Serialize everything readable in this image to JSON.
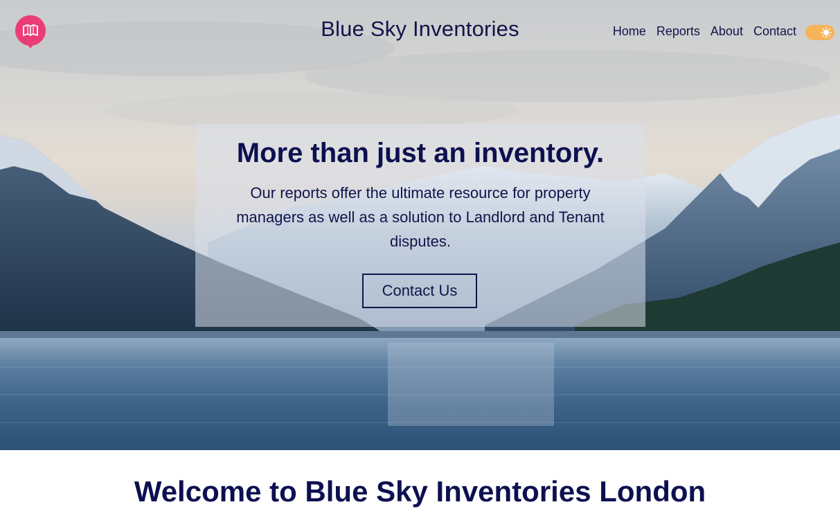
{
  "header": {
    "site_title": "Blue Sky Inventories",
    "logo_icon": "map-pin-book-icon",
    "nav": [
      {
        "label": "Home"
      },
      {
        "label": "Reports"
      },
      {
        "label": "About"
      },
      {
        "label": "Contact"
      }
    ],
    "theme_toggle_icon": "sun-icon"
  },
  "hero": {
    "background_image": "mountain-lake-landscape",
    "headline": "More than just an inventory.",
    "body": "Our reports offer the ultimate resource for property managers as well as a solution to Landlord and Tenant disputes.",
    "cta_label": "Contact Us"
  },
  "welcome": {
    "heading": "Welcome to Blue Sky Inventories London"
  },
  "colors": {
    "navy_text": "#11144a",
    "logo_pink": "#ea3d78",
    "toggle_orange": "#f7b35a",
    "page_bg": "#ffffff"
  }
}
